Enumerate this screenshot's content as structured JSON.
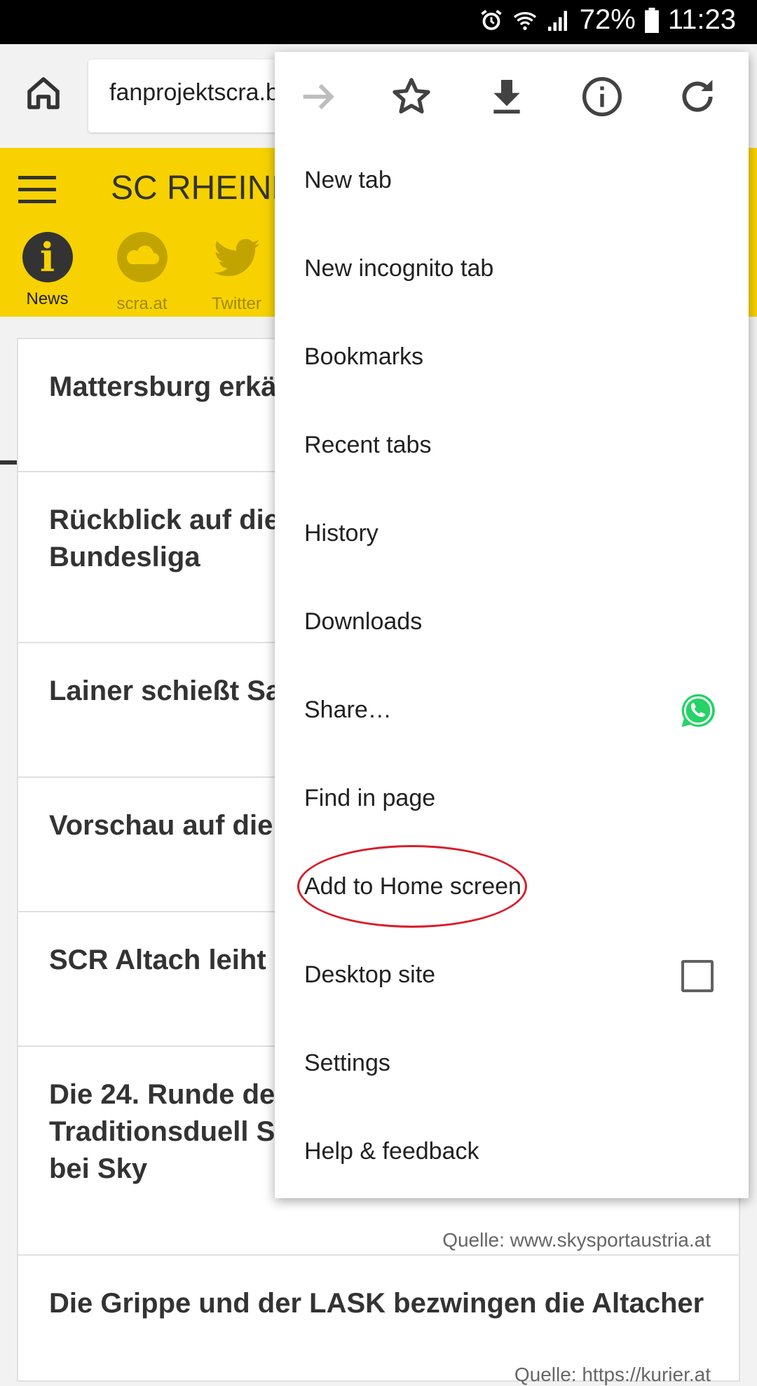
{
  "status": {
    "battery": "72%",
    "time": "11:23"
  },
  "browser": {
    "url": "fanprojektscra.b"
  },
  "site": {
    "title": "SC RHEIND",
    "tabs": [
      {
        "label": "News",
        "icon": "info-icon"
      },
      {
        "label": "scra.at",
        "icon": "cloud-icon"
      },
      {
        "label": "Twitter",
        "icon": "twitter-icon"
      }
    ]
  },
  "articles": [
    {
      "title": "Mattersburg erkä",
      "source": ""
    },
    {
      "title": "Rückblick auf die\nBundesliga",
      "source": ""
    },
    {
      "title": "Lainer schießt Sa",
      "source": ""
    },
    {
      "title": "Vorschau auf die",
      "source": ""
    },
    {
      "title": "SCR Altach leiht l",
      "source": ""
    },
    {
      "title": "Die 24. Runde der\nTraditionsduell Sl\nbei Sky",
      "source": "Quelle: www.skysportaustria.at"
    },
    {
      "title": "Die Grippe und der LASK bezwingen die Altacher",
      "source": "Quelle: https://kurier.at"
    }
  ],
  "menu": {
    "toolbar": [
      "forward-icon",
      "bookmark-star-icon",
      "download-icon",
      "info-icon",
      "reload-icon"
    ],
    "items": [
      "New tab",
      "New incognito tab",
      "Bookmarks",
      "Recent tabs",
      "History",
      "Downloads",
      "Share…",
      "Find in page",
      "Add to Home screen",
      "Desktop site",
      "Settings",
      "Help & feedback"
    ]
  },
  "colors": {
    "site_yellow": "#f7d200",
    "highlight_red": "#d81e2a",
    "whatsapp_green": "#25d366"
  }
}
